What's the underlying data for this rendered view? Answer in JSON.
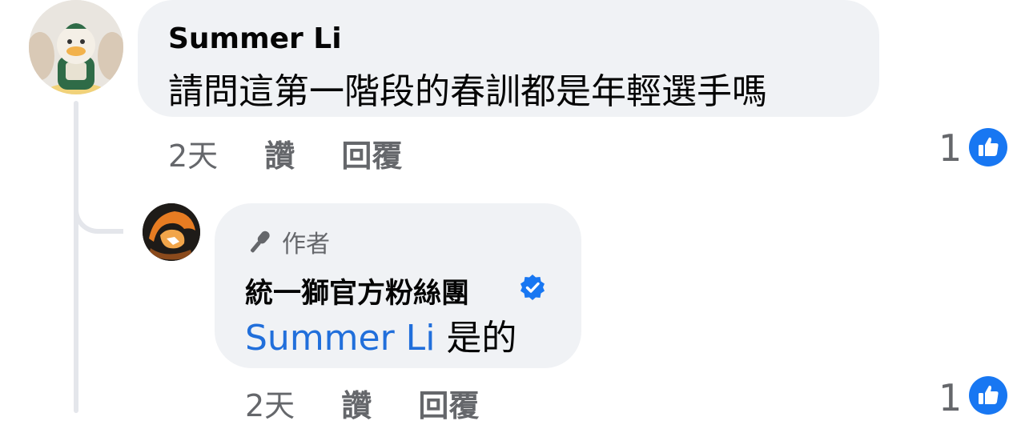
{
  "comment": {
    "author": "Summer Li",
    "text": "請問這第一階段的春訓都是年輕選手嗎",
    "time": "2天",
    "like_label": "讚",
    "reply_label": "回覆",
    "like_count": "1"
  },
  "reply": {
    "badge": "作者",
    "author": "統一獅官方粉絲團",
    "mention": "Summer Li",
    "text": " 是的",
    "time": "2天",
    "like_label": "讚",
    "reply_label": "回覆",
    "like_count": "1"
  },
  "icons": {
    "like": "thumbs-up-icon",
    "verified": "verified-badge-icon",
    "badge": "microphone-icon"
  },
  "colors": {
    "bubble": "#f0f2f5",
    "meta_text": "#65676b",
    "mention": "#216fdb",
    "verified": "#1877f2",
    "like_badge": "#1877f2"
  }
}
